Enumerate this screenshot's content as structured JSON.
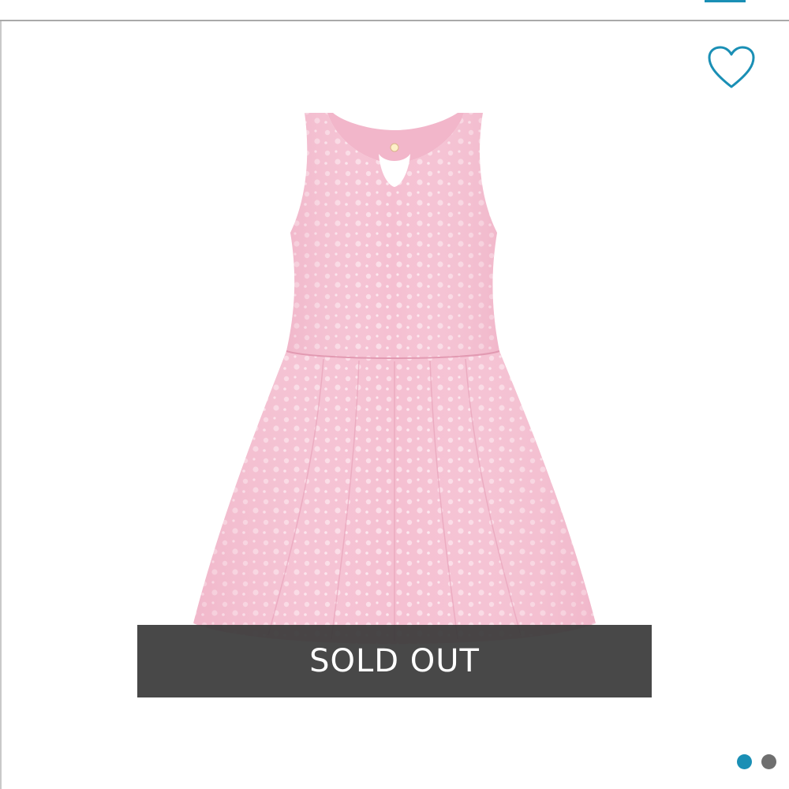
{
  "status": {
    "sold_out_label": "SOLD OUT"
  },
  "icons": {
    "favorite": "heart-outline-icon"
  },
  "colors": {
    "accent": "#1a8fb5",
    "dot_active": "#1a8fb5",
    "dot_inactive": "#6f6f6f",
    "banner": "#3a3a3a",
    "product": "#f6c2d3"
  },
  "carousel": {
    "total_images": 2,
    "active_index": 0
  }
}
